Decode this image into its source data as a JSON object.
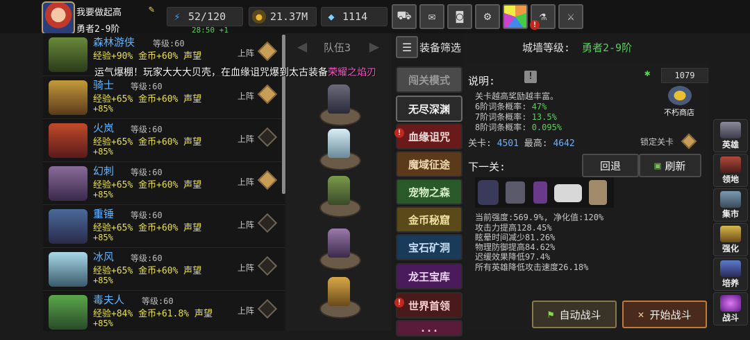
{
  "player": {
    "name": "我要做起高",
    "rank": "勇者2-9阶"
  },
  "stats": {
    "energy": "52/120",
    "energy_timer": "28:50 +1",
    "gold": "21.37M",
    "gems": "1114"
  },
  "toolbar_icons": [
    "cart-icon",
    "mail-icon",
    "gamepad-icon",
    "gear-icon",
    "color-wheel-icon",
    "flask-icon",
    "swords-icon"
  ],
  "heroes": [
    {
      "name": "森林游侠",
      "level": "等级:60",
      "exp": "经验+90%",
      "gold": "金币+60%",
      "rep": "声望",
      "extra": "",
      "deploy": "上阵",
      "active": true
    },
    {
      "name": "骑士",
      "level": "等级:60",
      "exp": "经验+65%",
      "gold": "金币+60%",
      "rep": "声望",
      "extra": "+85%",
      "deploy": "上阵",
      "active": true
    },
    {
      "name": "火岚",
      "level": "等级:60",
      "exp": "经验+65%",
      "gold": "金币+60%",
      "rep": "声望",
      "extra": "+85%",
      "deploy": "上阵",
      "active": false
    },
    {
      "name": "幻刺",
      "level": "等级:60",
      "exp": "经验+65%",
      "gold": "金币+60%",
      "rep": "声望",
      "extra": "+85%",
      "deploy": "上阵",
      "active": true
    },
    {
      "name": "重锤",
      "level": "等级:60",
      "exp": "经验+65%",
      "gold": "金币+60%",
      "rep": "声望",
      "extra": "+85%",
      "deploy": "上阵",
      "active": false
    },
    {
      "name": "冰风",
      "level": "等级:60",
      "exp": "经验+65%",
      "gold": "金币+60%",
      "rep": "声望",
      "extra": "+85%",
      "deploy": "上阵",
      "active": false
    },
    {
      "name": "毒夫人",
      "level": "等级:60",
      "exp": "经验+84%",
      "gold": "金币+61.8%",
      "rep": "声望",
      "extra": "+85%",
      "deploy": "上阵",
      "active": false
    }
  ],
  "chat_message": {
    "prefix": "运气爆棚！玩家大大大贝壳，在血缘诅咒爆到太古装备",
    "item": "荣耀之焰刃"
  },
  "team": {
    "label": "队伍3"
  },
  "filter_label": "装备筛选",
  "wall": {
    "label": "城墙等级:",
    "value": "勇者2-9阶"
  },
  "modes": [
    {
      "label": "闯关模式",
      "alert": false
    },
    {
      "label": "无尽深渊",
      "alert": false
    },
    {
      "label": "血缘诅咒",
      "alert": true
    },
    {
      "label": "魔域征途",
      "alert": false
    },
    {
      "label": "宠物之森",
      "alert": false
    },
    {
      "label": "金币秘窟",
      "alert": false
    },
    {
      "label": "宝石矿洞",
      "alert": false
    },
    {
      "label": "龙王宝库",
      "alert": false
    },
    {
      "label": "世界首领",
      "alert": true
    },
    {
      "label": "...",
      "alert": false
    }
  ],
  "info": {
    "desc_label": "说明:",
    "desc_line": "关卡越高奖励越丰富。",
    "rates": [
      {
        "label": "6阶词条概率:",
        "value": "47%"
      },
      {
        "label": "7阶词条概率:",
        "value": "13.5%"
      },
      {
        "label": "8阶词条概率:",
        "value": "0.095%"
      }
    ],
    "currency": "1079",
    "shop_label": "不朽商店",
    "stage_label": "关卡:",
    "stage_value": "4501",
    "max_label": "最高:",
    "max_value": "4642",
    "lock_label": "锁定关卡",
    "next_label": "下一关:",
    "back_label": "回退",
    "refresh_label": "刷新",
    "effects": [
      "当前强度:569.9%, 净化值:120%",
      "攻击力提高128.45%",
      "眩晕时间减少81.26%",
      "物理防御提高84.62%",
      "迟缓效果降低97.4%",
      "所有英雄降低攻击速度26.18%"
    ],
    "auto_label": "自动战斗",
    "start_label": "开始战斗"
  },
  "side_menu": [
    "英雄",
    "领地",
    "集市",
    "强化",
    "培养",
    "战斗"
  ]
}
